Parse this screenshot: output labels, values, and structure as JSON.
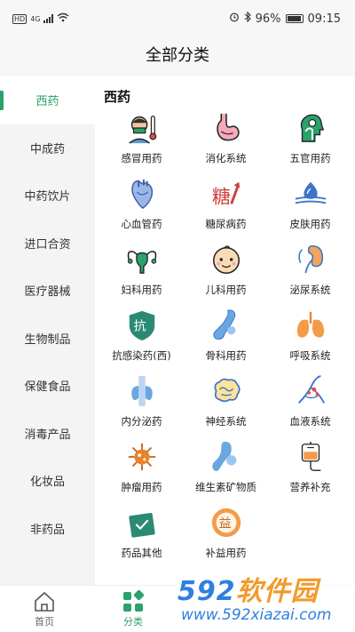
{
  "status": {
    "hd": "HD",
    "net": "4G",
    "battery": "96%",
    "time": "09:15"
  },
  "page_title": "全部分类",
  "sidebar": {
    "items": [
      {
        "label": "西药",
        "active": true
      },
      {
        "label": "中成药"
      },
      {
        "label": "中药饮片"
      },
      {
        "label": "进口合资"
      },
      {
        "label": "医疗器械"
      },
      {
        "label": "生物制品"
      },
      {
        "label": "保健食品"
      },
      {
        "label": "消毒产品"
      },
      {
        "label": "化妆品"
      },
      {
        "label": "非药品"
      }
    ]
  },
  "main": {
    "section_title": "西药",
    "categories": [
      {
        "label": "感冒用药",
        "icon": "cold-fever-icon"
      },
      {
        "label": "消化系统",
        "icon": "stomach-icon"
      },
      {
        "label": "五官用药",
        "icon": "head-ent-icon"
      },
      {
        "label": "心血管药",
        "icon": "heart-icon"
      },
      {
        "label": "糖尿病药",
        "icon": "sugar-icon",
        "icon_text": "糖"
      },
      {
        "label": "皮肤用药",
        "icon": "skin-icon"
      },
      {
        "label": "妇科用药",
        "icon": "uterus-icon"
      },
      {
        "label": "儿科用药",
        "icon": "baby-icon"
      },
      {
        "label": "泌尿系统",
        "icon": "kidney-icon"
      },
      {
        "label": "抗感染药(西)",
        "icon": "shield-icon",
        "icon_text": "抗"
      },
      {
        "label": "骨科用药",
        "icon": "bone-icon"
      },
      {
        "label": "呼吸系统",
        "icon": "lungs-icon"
      },
      {
        "label": "内分泌药",
        "icon": "thyroid-icon"
      },
      {
        "label": "神经系统",
        "icon": "brain-icon"
      },
      {
        "label": "血液系统",
        "icon": "blood-vessel-icon"
      },
      {
        "label": "肿瘤用药",
        "icon": "virus-icon"
      },
      {
        "label": "维生素矿物质",
        "icon": "joint-icon"
      },
      {
        "label": "营养补充",
        "icon": "iv-drip-icon"
      },
      {
        "label": "药品其他",
        "icon": "medicine-box-icon"
      },
      {
        "label": "补益用药",
        "icon": "tonic-jar-icon",
        "icon_text": "益"
      }
    ]
  },
  "tabbar": {
    "items": [
      {
        "label": "首页",
        "icon": "home-icon"
      },
      {
        "label": "分类",
        "icon": "category-icon",
        "active": true
      }
    ]
  },
  "watermark": {
    "brand_num": "592",
    "brand_text": "软件园",
    "url": "www.592xiazai.com"
  },
  "colors": {
    "accent": "#2aa26a",
    "sidebar_bg": "#f4f4f4"
  }
}
